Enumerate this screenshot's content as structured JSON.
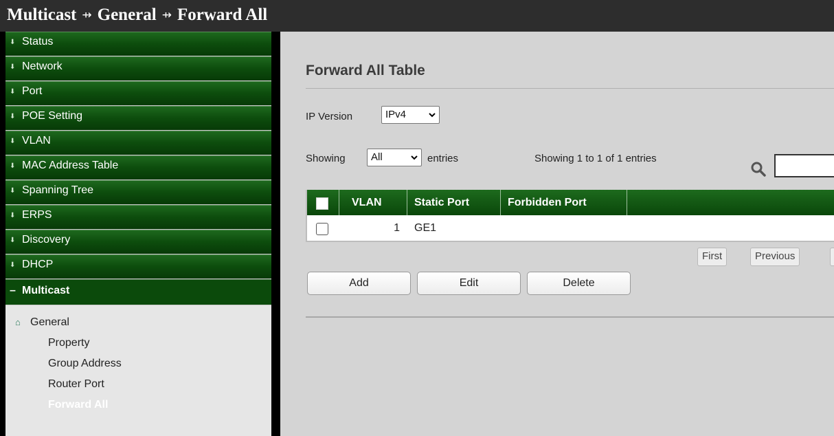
{
  "breadcrumb": {
    "items": [
      "Multicast",
      "General",
      "Forward All"
    ],
    "separator": "⇸"
  },
  "sidebar": {
    "items": [
      {
        "label": "Status"
      },
      {
        "label": "Network"
      },
      {
        "label": "Port"
      },
      {
        "label": "POE Setting"
      },
      {
        "label": "VLAN"
      },
      {
        "label": "MAC Address Table"
      },
      {
        "label": "Spanning Tree"
      },
      {
        "label": "ERPS"
      },
      {
        "label": "Discovery"
      },
      {
        "label": "DHCP"
      }
    ],
    "collapsed_marker": "⬇",
    "expanded": {
      "label": "Multicast",
      "marker": "–"
    },
    "submenu": {
      "group": "General",
      "links": [
        "Property",
        "Group Address",
        "Router Port",
        "Forward All"
      ],
      "active": "Forward All"
    }
  },
  "main": {
    "title": "Forward All Table",
    "ip_version": {
      "label": "IP Version",
      "value": "IPv4"
    },
    "entries": {
      "prefix": "Showing",
      "value": "All",
      "suffix": "entries"
    },
    "status": "Showing 1 to 1 of 1 entries",
    "search": {
      "value": ""
    },
    "table": {
      "columns": [
        "VLAN",
        "Static Port",
        "Forbidden Port"
      ],
      "rows": [
        {
          "vlan": "1",
          "static_port": "GE1",
          "forbidden_port": ""
        }
      ]
    },
    "pager": {
      "first": "First",
      "previous": "Previous"
    },
    "buttons": {
      "add": "Add",
      "edit": "Edit",
      "delete": "Delete"
    }
  },
  "colors": {
    "nav_green": "#0d4d0d",
    "header_green": "#1d6a1d",
    "topbar": "#2d2d2d",
    "content_bg": "#d4d4d4"
  }
}
